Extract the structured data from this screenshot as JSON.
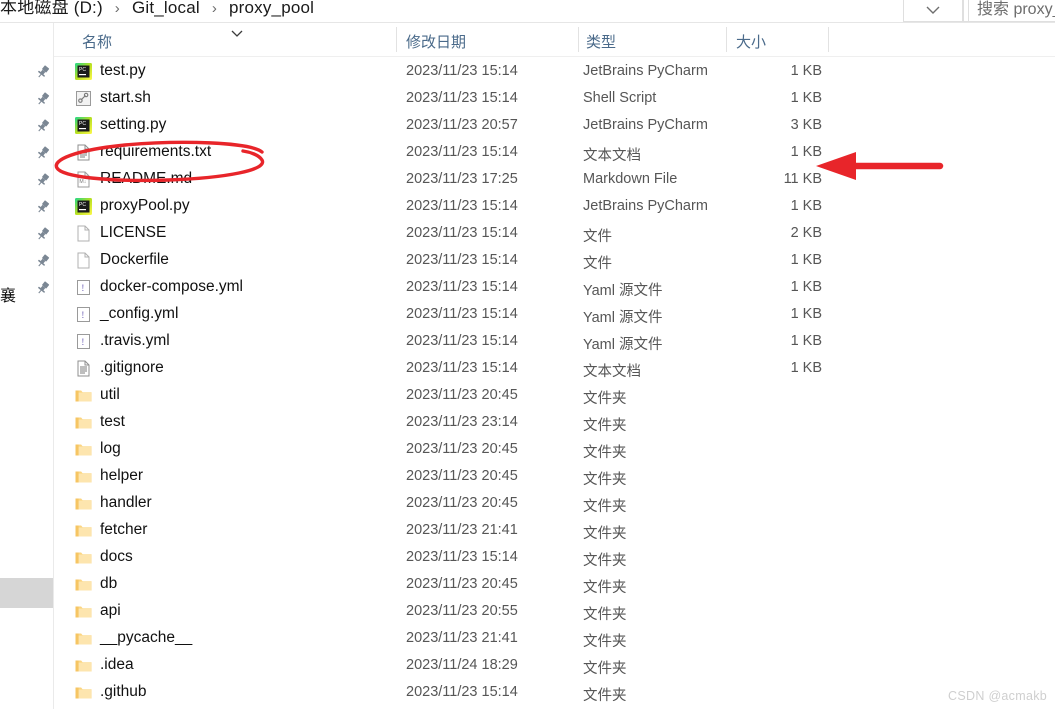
{
  "window": {
    "breadcrumb": {
      "segments": [
        "本地磁盘 (D:)",
        "Git_local",
        "proxy_pool"
      ],
      "separator": "›"
    },
    "history_button_icon": "chevron-down-icon",
    "refresh_button_icon": "refresh-icon",
    "search": {
      "placeholder": "搜索 proxy_",
      "value": ""
    }
  },
  "left_rail": {
    "clipped_label": "襄"
  },
  "columns": {
    "name": "名称",
    "date_modified": "修改日期",
    "type": "类型",
    "size": "大小"
  },
  "files": [
    {
      "name": "test.py",
      "date": "2023/11/23 15:14",
      "type": "JetBrains PyCharm",
      "size": "1 KB",
      "icon": "pycharm-file-icon"
    },
    {
      "name": "start.sh",
      "date": "2023/11/23 15:14",
      "type": "Shell Script",
      "size": "1 KB",
      "icon": "shell-script-icon"
    },
    {
      "name": "setting.py",
      "date": "2023/11/23 20:57",
      "type": "JetBrains PyCharm",
      "size": "3 KB",
      "icon": "pycharm-file-icon"
    },
    {
      "name": "requirements.txt",
      "date": "2023/11/23 15:14",
      "type": "文本文档",
      "size": "1 KB",
      "icon": "text-file-icon"
    },
    {
      "name": "README.md",
      "date": "2023/11/23 17:25",
      "type": "Markdown File",
      "size": "11 KB",
      "icon": "markdown-file-icon"
    },
    {
      "name": "proxyPool.py",
      "date": "2023/11/23 15:14",
      "type": "JetBrains PyCharm",
      "size": "1 KB",
      "icon": "pycharm-file-icon"
    },
    {
      "name": "LICENSE",
      "date": "2023/11/23 15:14",
      "type": "文件",
      "size": "2 KB",
      "icon": "blank-file-icon"
    },
    {
      "name": "Dockerfile",
      "date": "2023/11/23 15:14",
      "type": "文件",
      "size": "1 KB",
      "icon": "blank-file-icon"
    },
    {
      "name": "docker-compose.yml",
      "date": "2023/11/23 15:14",
      "type": "Yaml 源文件",
      "size": "1 KB",
      "icon": "yaml-file-icon"
    },
    {
      "name": "_config.yml",
      "date": "2023/11/23 15:14",
      "type": "Yaml 源文件",
      "size": "1 KB",
      "icon": "yaml-file-icon"
    },
    {
      "name": ".travis.yml",
      "date": "2023/11/23 15:14",
      "type": "Yaml 源文件",
      "size": "1 KB",
      "icon": "yaml-file-icon"
    },
    {
      "name": ".gitignore",
      "date": "2023/11/23 15:14",
      "type": "文本文档",
      "size": "1 KB",
      "icon": "text-file-icon"
    },
    {
      "name": "util",
      "date": "2023/11/23 20:45",
      "type": "文件夹",
      "size": "",
      "icon": "folder-icon"
    },
    {
      "name": "test",
      "date": "2023/11/23 23:14",
      "type": "文件夹",
      "size": "",
      "icon": "folder-icon"
    },
    {
      "name": "log",
      "date": "2023/11/23 20:45",
      "type": "文件夹",
      "size": "",
      "icon": "folder-icon"
    },
    {
      "name": "helper",
      "date": "2023/11/23 20:45",
      "type": "文件夹",
      "size": "",
      "icon": "folder-icon"
    },
    {
      "name": "handler",
      "date": "2023/11/23 20:45",
      "type": "文件夹",
      "size": "",
      "icon": "folder-icon"
    },
    {
      "name": "fetcher",
      "date": "2023/11/23 21:41",
      "type": "文件夹",
      "size": "",
      "icon": "folder-icon"
    },
    {
      "name": "docs",
      "date": "2023/11/23 15:14",
      "type": "文件夹",
      "size": "",
      "icon": "folder-icon"
    },
    {
      "name": "db",
      "date": "2023/11/23 20:45",
      "type": "文件夹",
      "size": "",
      "icon": "folder-icon"
    },
    {
      "name": "api",
      "date": "2023/11/23 20:55",
      "type": "文件夹",
      "size": "",
      "icon": "folder-icon"
    },
    {
      "name": "__pycache__",
      "date": "2023/11/23 21:41",
      "type": "文件夹",
      "size": "",
      "icon": "folder-icon"
    },
    {
      "name": ".idea",
      "date": "2023/11/24 18:29",
      "type": "文件夹",
      "size": "",
      "icon": "folder-icon"
    },
    {
      "name": ".github",
      "date": "2023/11/23 15:14",
      "type": "文件夹",
      "size": "",
      "icon": "folder-icon"
    }
  ],
  "pinned_rows": [
    0,
    1,
    2,
    3,
    4,
    5,
    6,
    7,
    8
  ],
  "annotations": {
    "color": "#e8252a",
    "ellipse_target": "requirements.txt",
    "arrow_target_row": "requirements.txt",
    "arrow_direction": "left"
  },
  "watermark": "CSDN @acmakb"
}
